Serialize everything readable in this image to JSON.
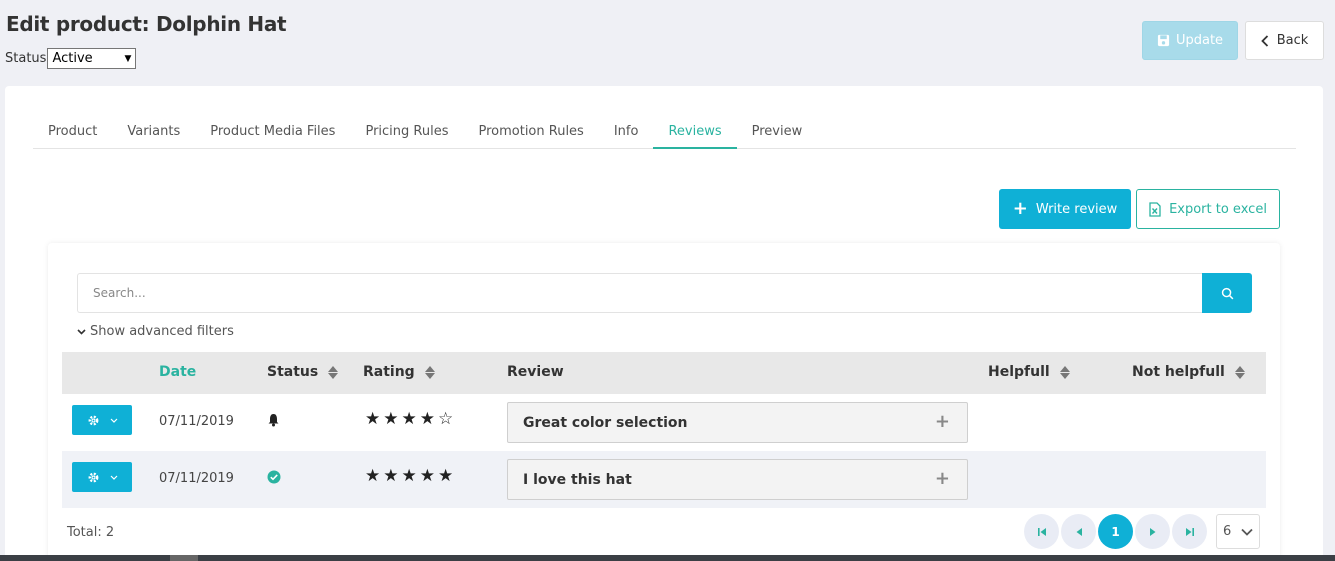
{
  "header": {
    "title": "Edit product: Dolphin Hat",
    "status_label": "Status",
    "status_value": "Active"
  },
  "actions": {
    "update_label": "Update",
    "back_label": "Back"
  },
  "tabs": [
    {
      "label": "Product"
    },
    {
      "label": "Variants"
    },
    {
      "label": "Product Media Files"
    },
    {
      "label": "Pricing Rules"
    },
    {
      "label": "Promotion Rules"
    },
    {
      "label": "Info"
    },
    {
      "label": "Reviews",
      "active": true
    },
    {
      "label": "Preview"
    }
  ],
  "toolbar": {
    "write_review_label": "Write review",
    "export_label": "Export to excel"
  },
  "search": {
    "placeholder": "Search...",
    "advanced_filters_label": "Show advanced filters"
  },
  "table": {
    "columns": {
      "date": "Date",
      "status": "Status",
      "rating": "Rating",
      "review": "Review",
      "helpful": "Helpfull",
      "not_helpful": "Not helpfull"
    },
    "rows": [
      {
        "date": "07/11/2019",
        "status_icon": "bell-icon",
        "rating": 4,
        "stars": "★★★★☆",
        "review": "Great color selection",
        "helpful": "",
        "not_helpful": ""
      },
      {
        "date": "07/11/2019",
        "status_icon": "check-circle-icon",
        "rating": 5,
        "stars": "★★★★★",
        "review": "I love this hat",
        "helpful": "",
        "not_helpful": ""
      }
    ]
  },
  "footer": {
    "total": "Total: 2",
    "current_page": "1",
    "per_page": "6"
  },
  "colors": {
    "accent": "#0fb0d6",
    "teal": "#2ab3a0",
    "update_disabled": "#a8dbea"
  }
}
